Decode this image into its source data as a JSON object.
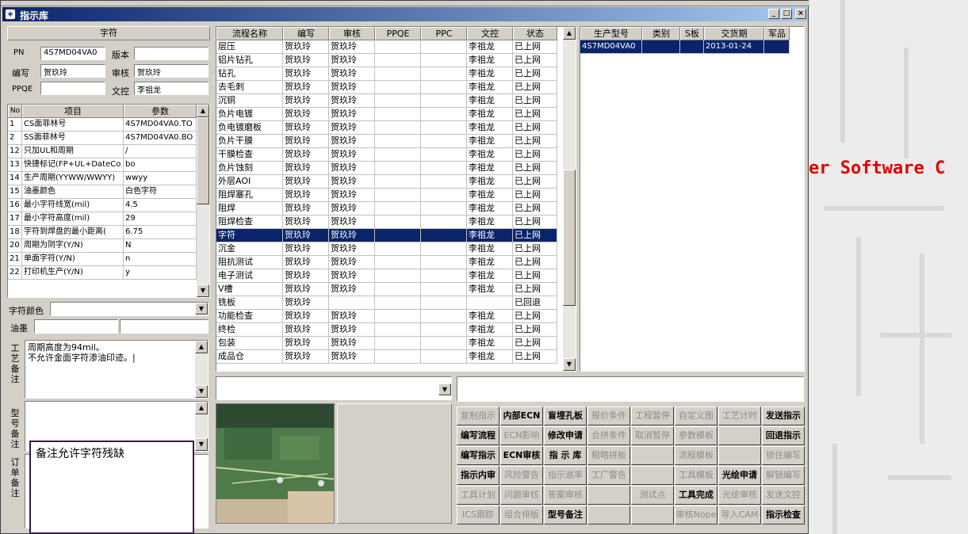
{
  "window": {
    "title": "指示库"
  },
  "background_text": "er Software C",
  "info": {
    "header": "字符",
    "pn_label": "PN",
    "pn_value": "4S7MD04VA0",
    "version_label": "版本",
    "version_value": "",
    "editor_label": "编写",
    "editor_value": "贺玖玲",
    "reviewer_label": "审核",
    "reviewer_value": "贺玖玲",
    "ppqe_label": "PPQE",
    "ppqe_value": "",
    "doc_label": "文控",
    "doc_value": "李祖龙"
  },
  "params": {
    "headers": [
      "No",
      "项目",
      "参数"
    ],
    "rows": [
      {
        "no": "1",
        "item": "CS面菲林号",
        "value": "4S7MD04VA0.TO"
      },
      {
        "no": "2",
        "item": "SS面菲林号",
        "value": "4S7MD04VA0.BO"
      },
      {
        "no": "12",
        "item": "只加UL和周期",
        "value": "/"
      },
      {
        "no": "13",
        "item": "快捷标记(FP+UL+DateCo",
        "value": "bo"
      },
      {
        "no": "14",
        "item": "生产周期(YYWW/WWYY)",
        "value": "wwyy"
      },
      {
        "no": "15",
        "item": "油墨颜色",
        "value": "白色字符"
      },
      {
        "no": "16",
        "item": "最小字符线宽(mil)",
        "value": "4.5"
      },
      {
        "no": "17",
        "item": "最小字符高度(mil)",
        "value": "29"
      },
      {
        "no": "18",
        "item": "字符到焊盘的最小距离(",
        "value": "6.75"
      },
      {
        "no": "20",
        "item": "周期为阴字(Y/N)",
        "value": "N"
      },
      {
        "no": "21",
        "item": "单面字符(Y/N)",
        "value": "n"
      },
      {
        "no": "22",
        "item": "打印机生产(Y/N)",
        "value": "y"
      }
    ]
  },
  "char_color_label": "字符颜色",
  "ink_label": "油墨",
  "process_note": {
    "label": "工艺备注",
    "lines": [
      "周期高度为94mil。",
      "不允许金面字符渗油印迹。|"
    ]
  },
  "model_note": {
    "label": "型号备注"
  },
  "order_note": {
    "label": "订单备注"
  },
  "popup_note": "备注允许字符残缺",
  "process": {
    "headers": [
      "流程名称",
      "编写",
      "审核",
      "PPQE",
      "PPC",
      "文控",
      "状态"
    ],
    "rows": [
      {
        "name": "层压",
        "editor": "贺玖玲",
        "reviewer": "贺玖玲",
        "ppqe": "",
        "ppc": "",
        "doc": "李祖龙",
        "status": "已上网"
      },
      {
        "name": "铝片钻孔",
        "editor": "贺玖玲",
        "reviewer": "贺玖玲",
        "ppqe": "",
        "ppc": "",
        "doc": "李祖龙",
        "status": "已上网"
      },
      {
        "name": "钻孔",
        "editor": "贺玖玲",
        "reviewer": "贺玖玲",
        "ppqe": "",
        "ppc": "",
        "doc": "李祖龙",
        "status": "已上网"
      },
      {
        "name": "去毛刺",
        "editor": "贺玖玲",
        "reviewer": "贺玖玲",
        "ppqe": "",
        "ppc": "",
        "doc": "李祖龙",
        "status": "已上网"
      },
      {
        "name": "沉铜",
        "editor": "贺玖玲",
        "reviewer": "贺玖玲",
        "ppqe": "",
        "ppc": "",
        "doc": "李祖龙",
        "status": "已上网"
      },
      {
        "name": "负片电镀",
        "editor": "贺玖玲",
        "reviewer": "贺玖玲",
        "ppqe": "",
        "ppc": "",
        "doc": "李祖龙",
        "status": "已上网"
      },
      {
        "name": "负电镀磨板",
        "editor": "贺玖玲",
        "reviewer": "贺玖玲",
        "ppqe": "",
        "ppc": "",
        "doc": "李祖龙",
        "status": "已上网"
      },
      {
        "name": "负片干膜",
        "editor": "贺玖玲",
        "reviewer": "贺玖玲",
        "ppqe": "",
        "ppc": "",
        "doc": "李祖龙",
        "status": "已上网"
      },
      {
        "name": "干膜检查",
        "editor": "贺玖玲",
        "reviewer": "贺玖玲",
        "ppqe": "",
        "ppc": "",
        "doc": "李祖龙",
        "status": "已上网"
      },
      {
        "name": "负片蚀刻",
        "editor": "贺玖玲",
        "reviewer": "贺玖玲",
        "ppqe": "",
        "ppc": "",
        "doc": "李祖龙",
        "status": "已上网"
      },
      {
        "name": "外层AOI",
        "editor": "贺玖玲",
        "reviewer": "贺玖玲",
        "ppqe": "",
        "ppc": "",
        "doc": "李祖龙",
        "status": "已上网"
      },
      {
        "name": "阻焊塞孔",
        "editor": "贺玖玲",
        "reviewer": "贺玖玲",
        "ppqe": "",
        "ppc": "",
        "doc": "李祖龙",
        "status": "已上网"
      },
      {
        "name": "阻焊",
        "editor": "贺玖玲",
        "reviewer": "贺玖玲",
        "ppqe": "",
        "ppc": "",
        "doc": "李祖龙",
        "status": "已上网"
      },
      {
        "name": "阻焊检查",
        "editor": "贺玖玲",
        "reviewer": "贺玖玲",
        "ppqe": "",
        "ppc": "",
        "doc": "李祖龙",
        "status": "已上网"
      },
      {
        "name": "字符",
        "editor": "贺玖玲",
        "reviewer": "贺玖玲",
        "ppqe": "",
        "ppc": "",
        "doc": "李祖龙",
        "status": "已上网"
      },
      {
        "name": "沉金",
        "editor": "贺玖玲",
        "reviewer": "贺玖玲",
        "ppqe": "",
        "ppc": "",
        "doc": "李祖龙",
        "status": "已上网"
      },
      {
        "name": "阻抗测试",
        "editor": "贺玖玲",
        "reviewer": "贺玖玲",
        "ppqe": "",
        "ppc": "",
        "doc": "李祖龙",
        "status": "已上网"
      },
      {
        "name": "电子测试",
        "editor": "贺玖玲",
        "reviewer": "贺玖玲",
        "ppqe": "",
        "ppc": "",
        "doc": "李祖龙",
        "status": "已上网"
      },
      {
        "name": "V槽",
        "editor": "贺玖玲",
        "reviewer": "贺玖玲",
        "ppqe": "",
        "ppc": "",
        "doc": "李祖龙",
        "status": "已上网"
      },
      {
        "name": "铣板",
        "editor": "贺玖玲",
        "reviewer": "",
        "ppqe": "",
        "ppc": "",
        "doc": "",
        "status": "已回退"
      },
      {
        "name": "功能检查",
        "editor": "贺玖玲",
        "reviewer": "贺玖玲",
        "ppqe": "",
        "ppc": "",
        "doc": "李祖龙",
        "status": "已上网"
      },
      {
        "name": "终检",
        "editor": "贺玖玲",
        "reviewer": "贺玖玲",
        "ppqe": "",
        "ppc": "",
        "doc": "李祖龙",
        "status": "已上网"
      },
      {
        "name": "包装",
        "editor": "贺玖玲",
        "reviewer": "贺玖玲",
        "ppqe": "",
        "ppc": "",
        "doc": "李祖龙",
        "status": "已上网"
      },
      {
        "name": "成品仓",
        "editor": "贺玖玲",
        "reviewer": "贺玖玲",
        "ppqe": "",
        "ppc": "",
        "doc": "李祖龙",
        "status": "已上网"
      }
    ],
    "selected_index": 14
  },
  "models": {
    "headers": [
      "生产型号",
      "类别",
      "S板",
      "交货期",
      "军品"
    ],
    "rows": [
      {
        "model": "4S7MD04VA0",
        "category": "",
        "sboard": "",
        "delivery": "2013-01-24",
        "military": ""
      }
    ]
  },
  "buttons": [
    [
      {
        "l": "复制指示",
        "d": true
      },
      {
        "l": "内部ECN",
        "d": false
      },
      {
        "l": "盲埋孔板",
        "d": false
      },
      {
        "l": "报价条件",
        "d": true
      },
      {
        "l": "工程暂停",
        "d": true
      },
      {
        "l": "自定义图",
        "d": true
      },
      {
        "l": "工艺计时",
        "d": true
      },
      {
        "l": "发送指示",
        "d": false
      }
    ],
    [
      {
        "l": "编写流程",
        "d": false
      },
      {
        "l": "ECN影响",
        "d": true
      },
      {
        "l": "修改申请",
        "d": false
      },
      {
        "l": "合拼条件",
        "d": true
      },
      {
        "l": "取消暂停",
        "d": true
      },
      {
        "l": "参数模板",
        "d": true
      },
      {
        "l": "",
        "d": true
      },
      {
        "l": "回退指示",
        "d": false
      }
    ],
    [
      {
        "l": "编写指示",
        "d": false
      },
      {
        "l": "ECN审核",
        "d": false
      },
      {
        "l": "指 示 库",
        "d": false
      },
      {
        "l": "粗略拼板",
        "d": true
      },
      {
        "l": "",
        "d": true
      },
      {
        "l": "流程模板",
        "d": true
      },
      {
        "l": "",
        "d": true
      },
      {
        "l": "锁住编写",
        "d": true
      }
    ],
    [
      {
        "l": "指示内审",
        "d": false
      },
      {
        "l": "风险警告",
        "d": true
      },
      {
        "l": "指示退率",
        "d": true
      },
      {
        "l": "工厂警告",
        "d": true
      },
      {
        "l": "",
        "d": true
      },
      {
        "l": "工具模板",
        "d": true
      },
      {
        "l": "光绘申请",
        "d": false
      },
      {
        "l": "解锁编写",
        "d": true
      }
    ],
    [
      {
        "l": "工具计划",
        "d": true
      },
      {
        "l": "问题审核",
        "d": true
      },
      {
        "l": "答案审核",
        "d": true
      },
      {
        "l": "",
        "d": true
      },
      {
        "l": "测试点",
        "d": true
      },
      {
        "l": "工具完成",
        "d": false
      },
      {
        "l": "光绘审核",
        "d": true
      },
      {
        "l": "发送文控",
        "d": true
      }
    ],
    [
      {
        "l": "ICS跟踪",
        "d": true
      },
      {
        "l": "组合排版",
        "d": true
      },
      {
        "l": "型号备注",
        "d": false
      },
      {
        "l": "",
        "d": true
      },
      {
        "l": "",
        "d": true
      },
      {
        "l": "审核Nope",
        "d": true
      },
      {
        "l": "导入CAM",
        "d": true
      },
      {
        "l": "指示检查",
        "d": false
      }
    ]
  ]
}
